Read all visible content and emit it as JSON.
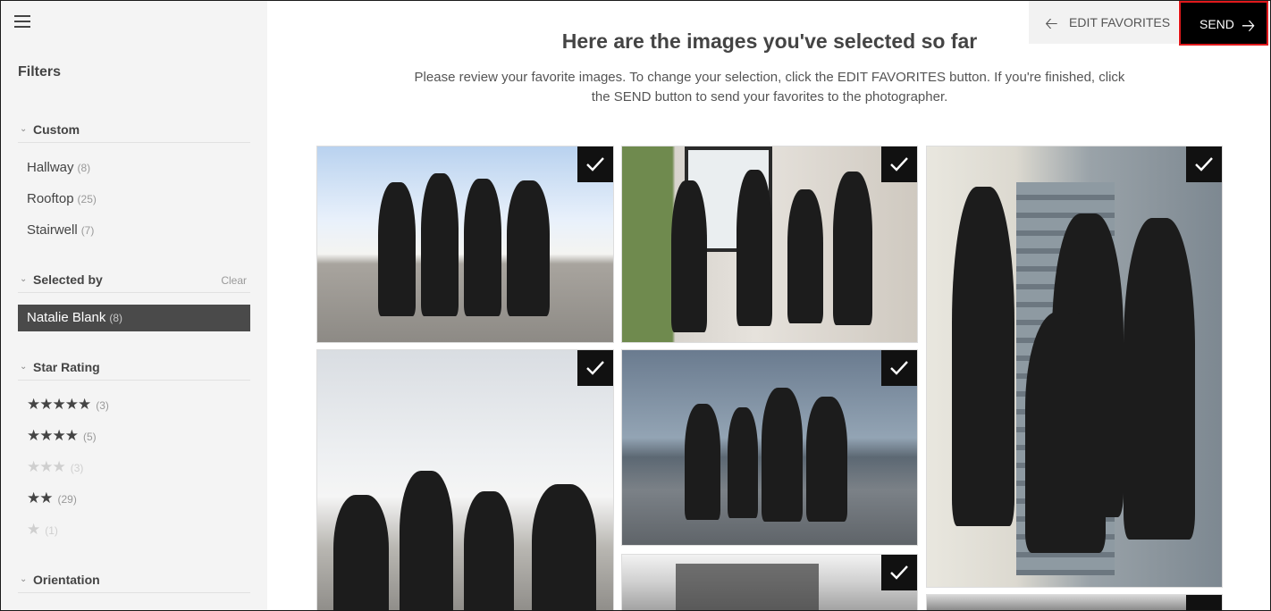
{
  "sidebar": {
    "filters_title": "Filters",
    "custom": {
      "label": "Custom",
      "items": [
        {
          "label": "Hallway",
          "count": "(8)"
        },
        {
          "label": "Rooftop",
          "count": "(25)"
        },
        {
          "label": "Stairwell",
          "count": "(7)"
        }
      ]
    },
    "selected_by": {
      "label": "Selected by",
      "clear": "Clear",
      "item": {
        "label": "Natalie Blank",
        "count": "(8)"
      }
    },
    "star_rating": {
      "label": "Star Rating",
      "items": [
        {
          "stars": "★★★★★",
          "count": "(3)",
          "level": 5
        },
        {
          "stars": "★★★★",
          "count": "(5)",
          "level": 4
        },
        {
          "stars": "★★★",
          "count": "(3)",
          "level": 3
        },
        {
          "stars": "★★",
          "count": "(29)",
          "level": 2
        },
        {
          "stars": "★",
          "count": "(1)",
          "level": 1
        }
      ]
    },
    "orientation": {
      "label": "Orientation"
    }
  },
  "toolbar": {
    "edit_favorites": "EDIT FAVORITES",
    "send": "SEND"
  },
  "main": {
    "heading": "Here are the images you've selected so far",
    "description": "Please review your favorite images. To change your selection, click the EDIT FAVORITES button. If you're finished, click the SEND button to send your favorites to the photographer."
  },
  "icons": {
    "menu": "hamburger-icon",
    "back": "arrow-left-icon",
    "forward": "arrow-right-icon",
    "check": "checkmark-icon",
    "collapse": "chevron-down-icon"
  },
  "colors": {
    "send_bg": "#000000",
    "send_highlight": "#e0191c",
    "sidebar_bg": "#f4f4f4",
    "selected_bg": "#4a4a4a"
  }
}
